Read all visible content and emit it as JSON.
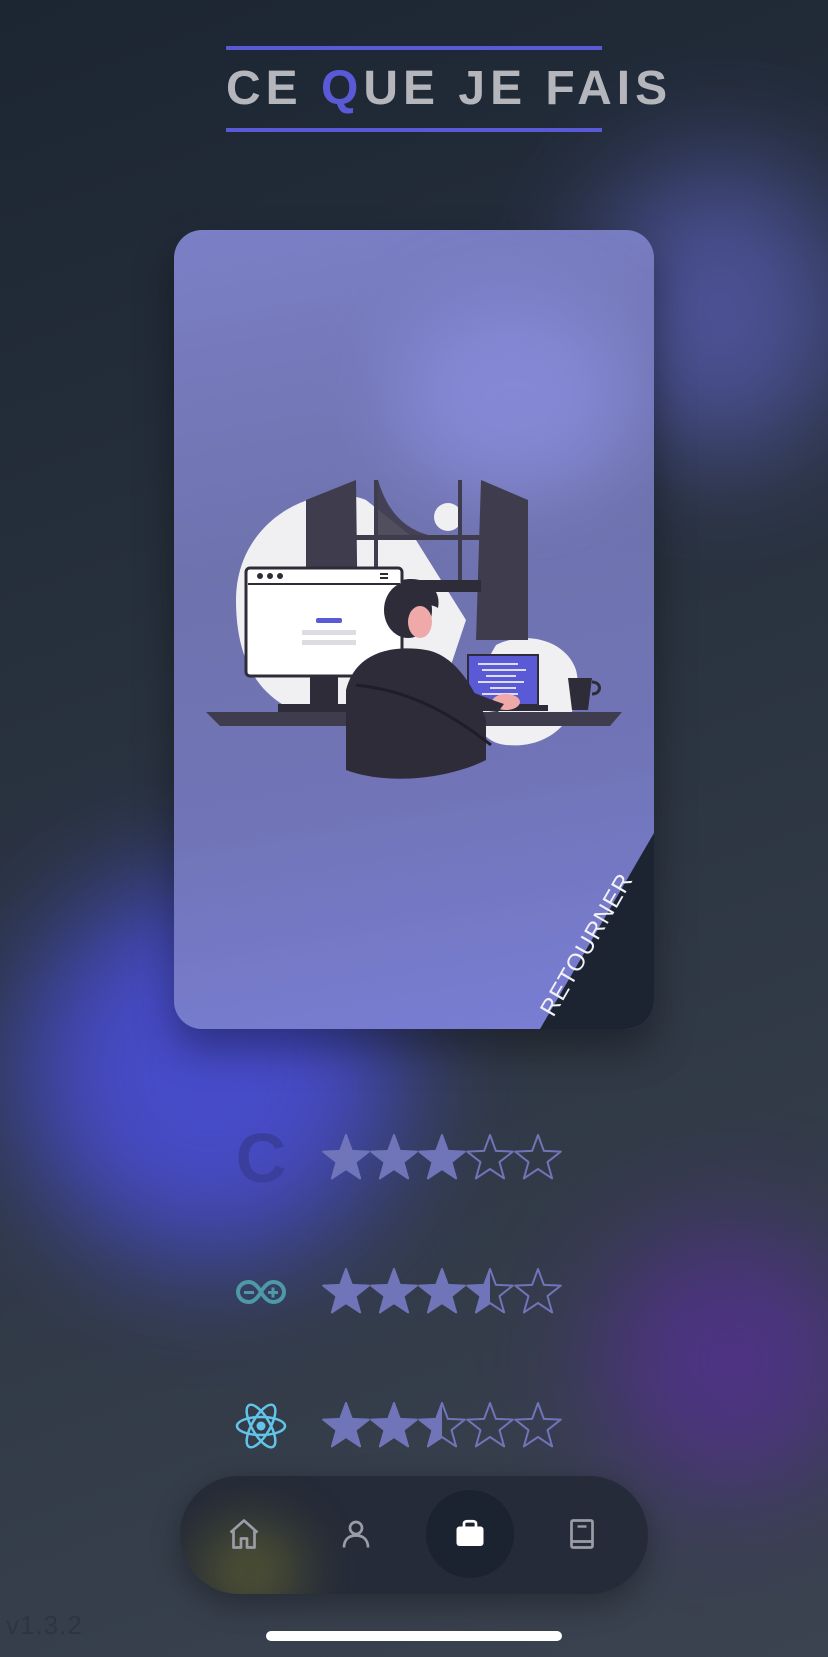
{
  "header": {
    "title_before": "CE ",
    "title_accent": "Q",
    "title_after": "UE JE FAIS",
    "accent_color": "#5a5ad6"
  },
  "card": {
    "corner_label": "RETOURNER",
    "illustration": "developer-at-desk-illustration"
  },
  "skills": [
    {
      "icon": "c-language-icon",
      "icon_text": "C",
      "rating": 3,
      "max": 5
    },
    {
      "icon": "arduino-icon",
      "rating": 3.5,
      "max": 5
    },
    {
      "icon": "react-icon",
      "rating": 2.5,
      "max": 5
    }
  ],
  "nav": {
    "items": [
      {
        "icon": "home-icon"
      },
      {
        "icon": "user-icon"
      },
      {
        "icon": "briefcase-icon",
        "active": true
      },
      {
        "icon": "book-icon"
      }
    ]
  },
  "footer": {
    "version": "v1.3.2"
  }
}
